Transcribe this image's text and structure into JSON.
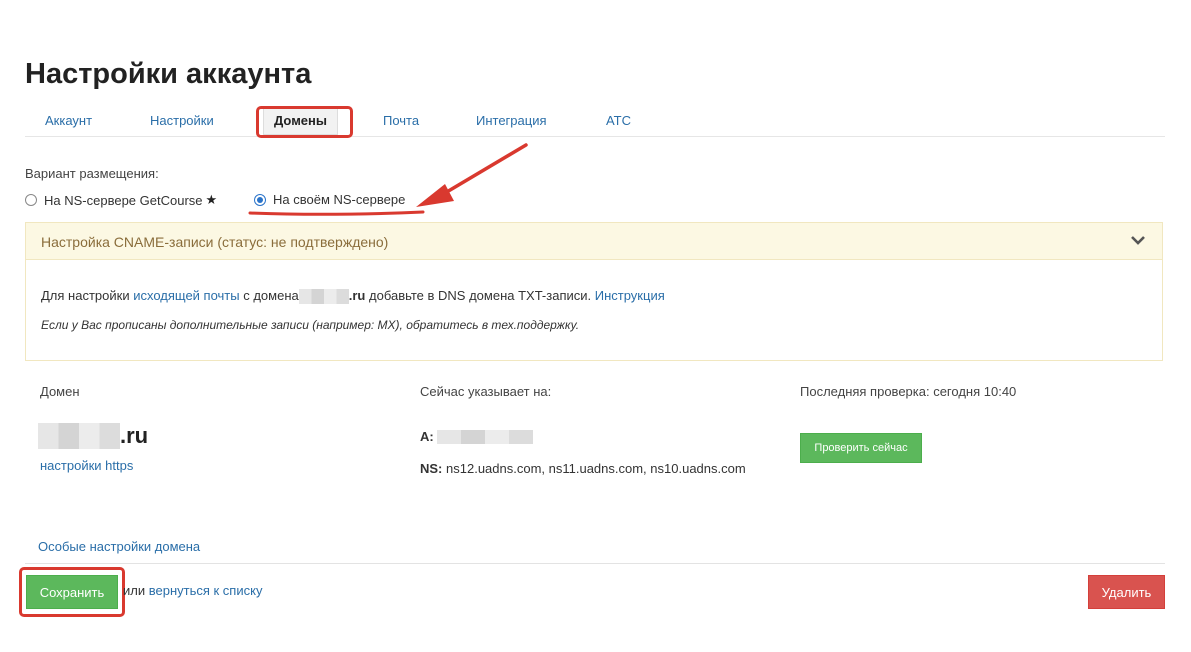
{
  "page_title": "Настройки аккаунта",
  "tabs": [
    {
      "label": "Аккаунт",
      "active": false
    },
    {
      "label": "Настройки",
      "active": false
    },
    {
      "label": "Домены",
      "active": true
    },
    {
      "label": "Почта",
      "active": false
    },
    {
      "label": "Интеграция",
      "active": false
    },
    {
      "label": "АТС",
      "active": false
    }
  ],
  "placement": {
    "label": "Вариант размещения:",
    "option_getcourse": "На NS-сервере GetCourse",
    "option_getcourse_star": "★",
    "option_own": "На своём NS-сервере",
    "selected": "option_own"
  },
  "cname_panel": {
    "title": "Настройка CNAME-записи (статус: не подтверждено)",
    "line1_prefix": "Для настройки",
    "line1_link": "исходящей почты",
    "line1_middle": "с домена",
    "line1_domain_suffix": ".ru",
    "line1_rest": "добавьте в DNS домена TXT-записи.",
    "line1_instruction": "Инструкция",
    "line2": "Если у Вас прописаны дополнительные записи (например: MX), обратитесь в тех.поддержку."
  },
  "domain_section": {
    "col_domain": "Домен",
    "col_points": "Сейчас указывает на:",
    "col_check": "Последняя проверка: сегодня 10:40",
    "domain_suffix": ".ru",
    "https_link": "настройки https",
    "a_label": "A:",
    "ns_label": "NS:",
    "ns_value": "ns12.uadns.com, ns11.uadns.com, ns10.uadns.com",
    "check_button": "Проверить сейчас"
  },
  "special_settings_link": "Особые настройки домена",
  "footer": {
    "save_button": "Сохранить",
    "or_text": "или",
    "back_link": "вернуться к списку",
    "delete_button": "Удалить"
  },
  "colors": {
    "accent_link": "#2a6ea8",
    "save_green": "#5cb85c",
    "delete_red": "#d9534f",
    "panel_warning_bg": "#fcf8e3",
    "annotation_red": "#d9392f"
  }
}
